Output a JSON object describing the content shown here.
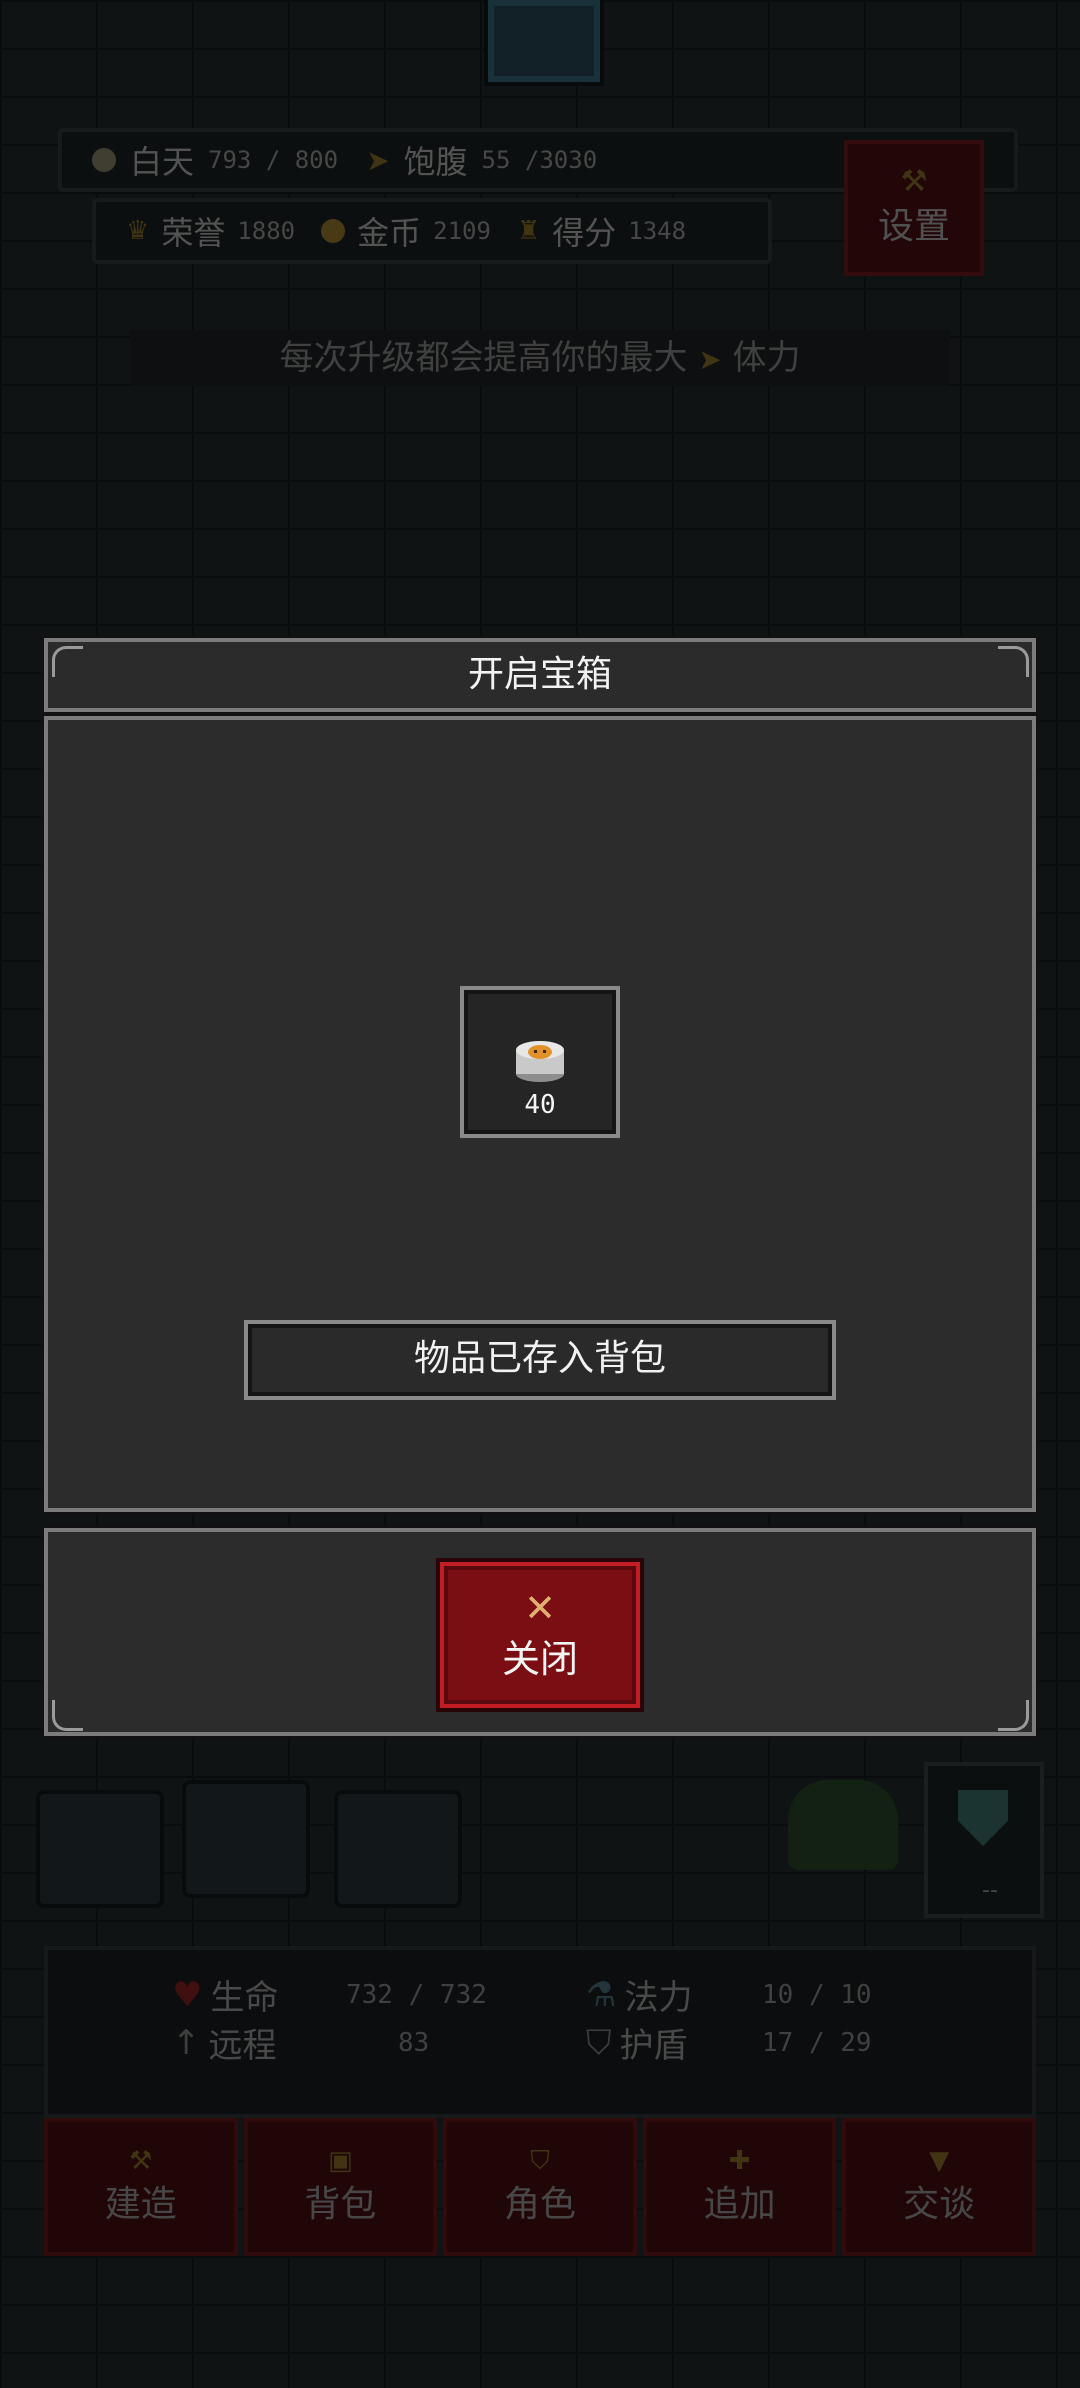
{
  "hud": {
    "day_label": "白天",
    "day_value": "793 / 800",
    "satiety_label": "饱腹",
    "satiety_value": "55 /3030",
    "honor_label": "荣誉",
    "honor_value": "1880",
    "gold_label": "金币",
    "gold_value": "2109",
    "score_label": "得分",
    "score_value": "1348",
    "settings_label": "设置"
  },
  "hint": {
    "text_before": "每次升级都会提高你的最大",
    "text_after": "体力"
  },
  "modal": {
    "title": "开启宝箱",
    "item": {
      "icon": "food-can-icon",
      "count": "40"
    },
    "stored_message": "物品已存入背包",
    "close_label": "关闭"
  },
  "status": {
    "hp_label": "生命",
    "hp_value": "732 / 732",
    "mana_label": "法力",
    "mana_value": "10 / 10",
    "ranged_label": "远程",
    "ranged_value": "83",
    "shield_label": "护盾",
    "shield_value": "17 / 29",
    "shield_panel_value": "--"
  },
  "nav": [
    {
      "label": "建造",
      "icon": "hammer-icon"
    },
    {
      "label": "背包",
      "icon": "bag-icon"
    },
    {
      "label": "角色",
      "icon": "character-icon"
    },
    {
      "label": "追加",
      "icon": "plus-icon"
    },
    {
      "label": "交谈",
      "icon": "chat-icon"
    }
  ],
  "colors": {
    "accent_red": "#7a0e13",
    "close_border": "#c21d24",
    "panel": "#2c2c2c",
    "gold": "#e0b070"
  }
}
